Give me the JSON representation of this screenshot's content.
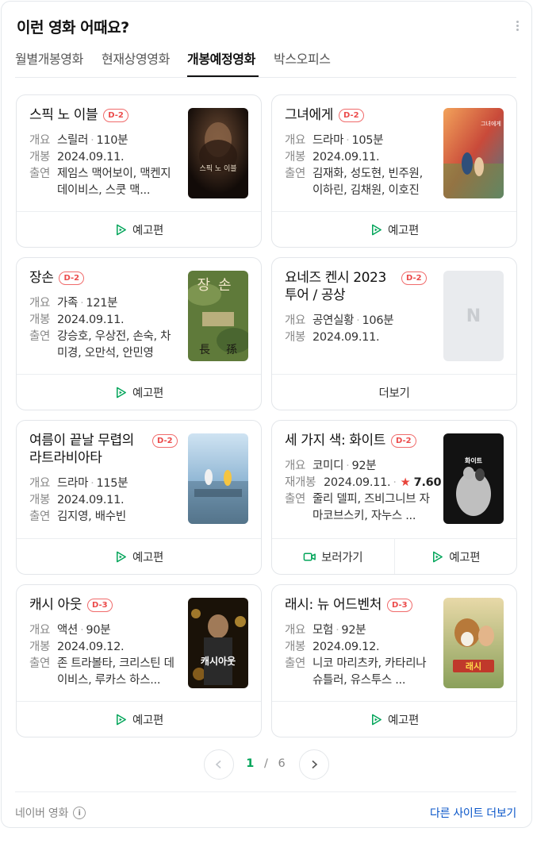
{
  "header": {
    "title": "이런 영화 어때요?"
  },
  "tabs": [
    {
      "label": "월별개봉영화"
    },
    {
      "label": "현재상영영화"
    },
    {
      "label": "개봉예정영화",
      "active": true
    },
    {
      "label": "박스오피스"
    }
  ],
  "labels": {
    "summary": "개요",
    "release": "개봉",
    "rerelease": "재개봉",
    "cast": "출연",
    "trailer": "예고편",
    "more": "더보기",
    "watch": "보러가기"
  },
  "movies": [
    {
      "title": "스픽 노 이블",
      "dday": "D-2",
      "genre": "스릴러",
      "runtime": "110분",
      "date": "2024.09.11.",
      "cast": "제임스 맥어보이, 맥켄지 데이비스, 스쿳 맥...",
      "poster_text": "스픽 노 이블"
    },
    {
      "title": "그녀에게",
      "dday": "D-2",
      "genre": "드라마",
      "runtime": "105분",
      "date": "2024.09.11.",
      "cast": "김재화, 성도현, 빈주원, 이하린, 김채원, 이호진",
      "poster_text": "그녀에게"
    },
    {
      "title": "장손",
      "dday": "D-2",
      "genre": "가족",
      "runtime": "121분",
      "date": "2024.09.11.",
      "cast": "강승호, 우상전, 손숙, 차미경, 오만석, 안민영",
      "poster_text": "장손"
    },
    {
      "title": "요네즈 켄시 2023 투어 / 공상",
      "dday": "D-2",
      "genre": "공연실황",
      "runtime": "106분",
      "date": "2024.09.11."
    },
    {
      "title": "여름이 끝날 무렵의 라트라비아타",
      "dday": "D-2",
      "genre": "드라마",
      "runtime": "115분",
      "date": "2024.09.11.",
      "cast": "김지영, 배수빈"
    },
    {
      "title": "세 가지 색: 화이트",
      "dday": "D-2",
      "genre": "코미디",
      "runtime": "92분",
      "date": "2024.09.11.",
      "rating": "7.60",
      "cast": "줄리 델피, 즈비그니브 자마코브스키, 자누스 ...",
      "poster_text": "화이트"
    },
    {
      "title": "캐시 아웃",
      "dday": "D-3",
      "genre": "액션",
      "runtime": "90분",
      "date": "2024.09.12.",
      "cast": "존 트라볼타, 크리스틴 데이비스, 루카스 하스...",
      "poster_text": "캐시아웃"
    },
    {
      "title": "래시: 뉴 어드벤처",
      "dday": "D-3",
      "genre": "모험",
      "runtime": "92분",
      "date": "2024.09.12.",
      "cast": "니코 마리츠카, 카타리나 슈틀러, 유스투스 ...",
      "poster_text": "래시"
    }
  ],
  "pagination": {
    "current": "1",
    "separator": "/",
    "total": "6"
  },
  "footer": {
    "source": "네이버 영화",
    "other_sites": "다른 사이트 더보기"
  },
  "colors": {
    "badge": "#eb4b4b",
    "accent_green": "#03a55a",
    "link_blue": "#0a56c9",
    "star": "#e8453c"
  }
}
